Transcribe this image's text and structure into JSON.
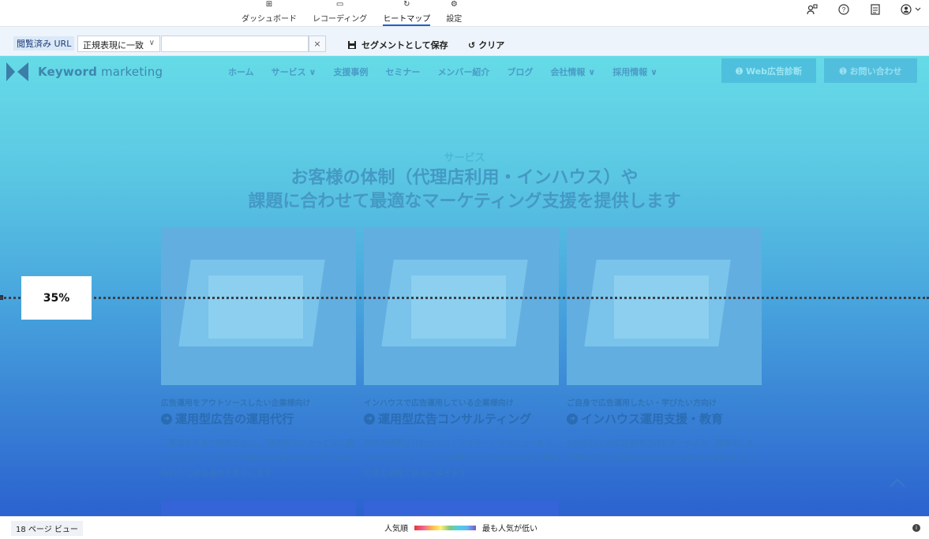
{
  "topnav": [
    {
      "label": "ダッシュボード",
      "icon": "dashboard-icon",
      "glyph": "⊞"
    },
    {
      "label": "レコーディング",
      "icon": "video-icon",
      "glyph": "▭"
    },
    {
      "label": "ヒートマップ",
      "icon": "heatmap-icon",
      "glyph": "↻",
      "active": true
    },
    {
      "label": "設定",
      "icon": "gear-icon",
      "glyph": "⚙"
    }
  ],
  "topright": {
    "icons": [
      "users-icon",
      "help-icon",
      "document-icon",
      "account-icon"
    ]
  },
  "filter": {
    "tag": "閲覧済み URL",
    "match_mode": "正規表現に一致",
    "url_value": "",
    "clear_x": "×",
    "save_label": "セグメントとして保存",
    "clear_label": "クリア"
  },
  "site": {
    "logo_bold": "Keyword",
    "logo_rest": " marketing",
    "nav": [
      "ホーム",
      "サービス ∨",
      "支援事例",
      "セミナー",
      "メンバー紹介",
      "ブログ",
      "会社情報 ∨",
      "採用情報 ∨"
    ],
    "btn1": "➊ Web広告診断",
    "btn2": "➊ お問い合わせ",
    "kicker": "サービス",
    "title_line1": "お客様の体制（代理店利用・インハウス）や",
    "title_line2": "課題に合わせて最適なマーケティング支援を提供します",
    "cards": [
      {
        "small": "広告運用をアウトソースしたい企業様向け",
        "big": "運用型広告の運用代行",
        "desc": "「要求するまで提案がない」「運用担当によって良し悪しが決まる」ではなく仕組み化と属人化のバランスが取れた代理店運用を提供します"
      },
      {
        "small": "インハウスで広告運用している企業様向け",
        "big": "運用型広告コンサルティング",
        "desc": "現状の課題に合わせてコンサルティングメニューをカスタマイズ。インハウス運用におけるお悩みを6ヶ月間の並走期間で解決に導きます"
      },
      {
        "small": "ご自身で広告運用したい・学びたい方向け",
        "big": "インハウス運用支援・教育",
        "desc": "600社以上の広告運用の研究データより、理論化した運用型広告で圧倒的な成果を出せる人材を養成します"
      }
    ]
  },
  "fold": {
    "label": "35%",
    "value_percent": 35
  },
  "status": {
    "pageviews": "18 ページ ビュー",
    "legend_left": "人気順",
    "legend_right": "最も人気が低い"
  },
  "colors": {
    "accent": "#1a62c7",
    "heatmap_top": "#65dbe7",
    "heatmap_bottom": "#2b62cf"
  }
}
